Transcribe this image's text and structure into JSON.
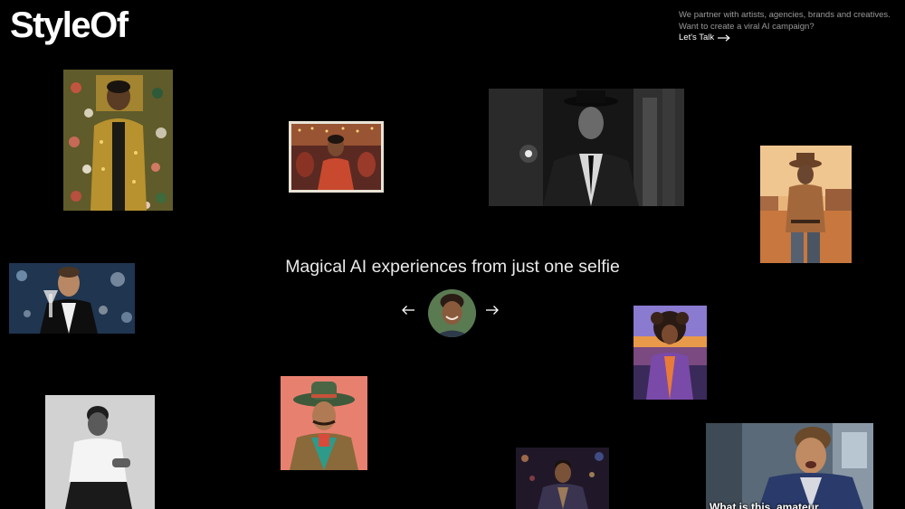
{
  "brand": {
    "logo_text": "StyleOf"
  },
  "header": {
    "partner_line1": "We partner with artists, agencies, brands and creatives.",
    "partner_line2": "Want to create a viral AI campaign?",
    "cta_label": "Let's Talk",
    "cta_icon": "arrow-right-icon"
  },
  "hero": {
    "headline": "Magical AI experiences from just one selfie",
    "prev_icon": "arrow-left-icon",
    "next_icon": "arrow-right-icon"
  },
  "gallery": {
    "items": [
      {
        "name": "klimt-style-portrait",
        "palette": [
          "#5e5a2c",
          "#b8952f",
          "#2e3b25"
        ]
      },
      {
        "name": "polaroid-party-portrait",
        "palette": [
          "#8a3b2a",
          "#d9a14c",
          "#3b1c1a"
        ]
      },
      {
        "name": "noir-detective-portrait",
        "palette": [
          "#2a2a2a",
          "#9a9a9a",
          "#0e0e0e"
        ]
      },
      {
        "name": "cowboy-desert-portrait",
        "palette": [
          "#c98a4c",
          "#7a4a2a",
          "#e6b678"
        ]
      },
      {
        "name": "gatsby-toast-portrait",
        "palette": [
          "#2c4a66",
          "#d8d8d8",
          "#101820"
        ]
      },
      {
        "name": "afro-sunset-painting-portrait",
        "palette": [
          "#6a3e8a",
          "#d88a3a",
          "#2a1f4a"
        ]
      },
      {
        "name": "mariachi-painting-portrait",
        "palette": [
          "#d87a6a",
          "#3e9a7a",
          "#8a5a2a"
        ]
      },
      {
        "name": "bw-studio-portrait",
        "palette": [
          "#cfcfcf",
          "#4a4a4a",
          "#1a1a1a"
        ]
      },
      {
        "name": "city-night-portrait",
        "palette": [
          "#2a1e2e",
          "#8a6a4a",
          "#4a3a6a"
        ]
      },
      {
        "name": "movie-scene-portrait",
        "palette": [
          "#4a5a6a",
          "#a87a5a",
          "#2a3a5a"
        ]
      }
    ],
    "movie_caption": "What is this, amateur"
  },
  "colors": {
    "background": "#000000",
    "text_primary": "#ffffff",
    "text_muted": "#9a9a9a"
  }
}
